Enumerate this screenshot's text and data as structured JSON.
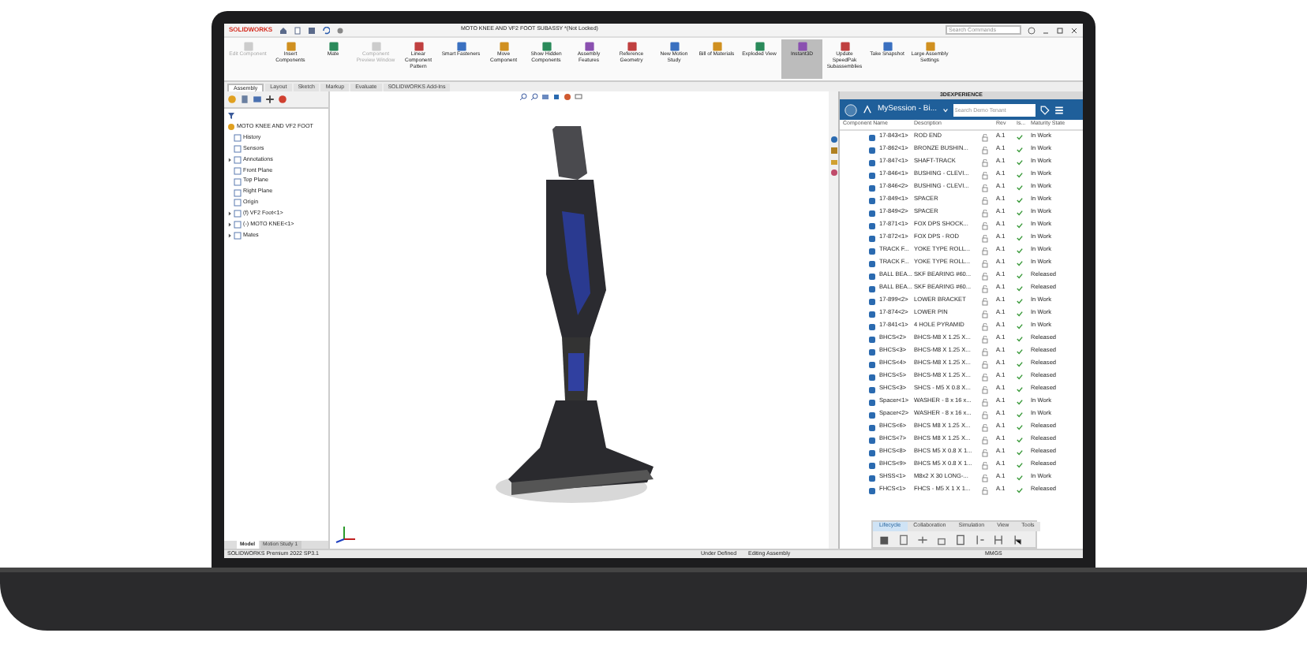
{
  "window": {
    "app": "SOLIDWORKS",
    "title": "MOTO KNEE AND VF2 FOOT SUBASSY *(Not Locked)",
    "search_placeholder": "Search Commands"
  },
  "ribbon": [
    {
      "label": "Edit Component",
      "disabled": true,
      "selected": false
    },
    {
      "label": "Insert Components",
      "disabled": false,
      "selected": false
    },
    {
      "label": "Mate",
      "disabled": false,
      "selected": false
    },
    {
      "label": "Component Preview Window",
      "disabled": true,
      "selected": false
    },
    {
      "label": "Linear Component Pattern",
      "disabled": false,
      "selected": false
    },
    {
      "label": "Smart Fasteners",
      "disabled": false,
      "selected": false
    },
    {
      "label": "Move Component",
      "disabled": false,
      "selected": false
    },
    {
      "label": "Show Hidden Components",
      "disabled": false,
      "selected": false
    },
    {
      "label": "Assembly Features",
      "disabled": false,
      "selected": false
    },
    {
      "label": "Reference Geometry",
      "disabled": false,
      "selected": false
    },
    {
      "label": "New Motion Study",
      "disabled": false,
      "selected": false
    },
    {
      "label": "Bill of Materials",
      "disabled": false,
      "selected": false
    },
    {
      "label": "Exploded View",
      "disabled": false,
      "selected": false
    },
    {
      "label": "Instant3D",
      "disabled": false,
      "selected": true
    },
    {
      "label": "Update SpeedPak Subassemblies",
      "disabled": false,
      "selected": false
    },
    {
      "label": "Take Snapshot",
      "disabled": false,
      "selected": false
    },
    {
      "label": "Large Assembly Settings",
      "disabled": false,
      "selected": false
    }
  ],
  "tabs": [
    {
      "label": "Assembly",
      "selected": true
    },
    {
      "label": "Layout",
      "selected": false
    },
    {
      "label": "Sketch",
      "selected": false
    },
    {
      "label": "Markup",
      "selected": false
    },
    {
      "label": "Evaluate",
      "selected": false
    },
    {
      "label": "SOLIDWORKS Add-Ins",
      "selected": false
    }
  ],
  "tree": {
    "root": "MOTO KNEE AND VF2 FOOT",
    "children": [
      {
        "label": "History",
        "has_children": false
      },
      {
        "label": "Sensors",
        "has_children": false
      },
      {
        "label": "Annotations",
        "has_children": true
      },
      {
        "label": "Front Plane",
        "has_children": false
      },
      {
        "label": "Top Plane",
        "has_children": false
      },
      {
        "label": "Right Plane",
        "has_children": false
      },
      {
        "label": "Origin",
        "has_children": false
      },
      {
        "label": "(f) VF2 Foot<1>",
        "has_children": true
      },
      {
        "label": "(-) MOTO KNEE<1>",
        "has_children": true
      },
      {
        "label": "Mates",
        "has_children": true
      }
    ]
  },
  "experience": {
    "header": "3DEXPERIENCE",
    "session": "MySession - Bi...",
    "search_placeholder": "Search Demo Tenant",
    "columns": [
      "Component Name",
      "Description",
      "Rev",
      "Is...",
      "Maturity State"
    ],
    "rows": [
      {
        "name": "17-843<1>",
        "description": "ROD END",
        "rev": "A.1",
        "checked": true,
        "state": "In Work"
      },
      {
        "name": "17-862<1>",
        "description": "BRONZE BUSHIN...",
        "rev": "A.1",
        "checked": true,
        "state": "In Work"
      },
      {
        "name": "17-847<1>",
        "description": "SHAFT-TRACK",
        "rev": "A.1",
        "checked": true,
        "state": "In Work"
      },
      {
        "name": "17-846<1>",
        "description": "BUSHING - CLEVI...",
        "rev": "A.1",
        "checked": true,
        "state": "In Work"
      },
      {
        "name": "17-846<2>",
        "description": "BUSHING - CLEVI...",
        "rev": "A.1",
        "checked": true,
        "state": "In Work"
      },
      {
        "name": "17-849<1>",
        "description": "SPACER",
        "rev": "A.1",
        "checked": true,
        "state": "In Work"
      },
      {
        "name": "17-849<2>",
        "description": "SPACER",
        "rev": "A.1",
        "checked": true,
        "state": "In Work"
      },
      {
        "name": "17-871<1>",
        "description": "FOX DPS SHOCK...",
        "rev": "A.1",
        "checked": true,
        "state": "In Work"
      },
      {
        "name": "17-872<1>",
        "description": "FOX DPS - ROD",
        "rev": "A.1",
        "checked": true,
        "state": "In Work"
      },
      {
        "name": "TRACK F...",
        "description": "YOKE TYPE ROLL...",
        "rev": "A.1",
        "checked": true,
        "state": "In Work"
      },
      {
        "name": "TRACK F...",
        "description": "YOKE TYPE ROLL...",
        "rev": "A.1",
        "checked": true,
        "state": "In Work"
      },
      {
        "name": "BALL BEA...",
        "description": "SKF BEARING #60...",
        "rev": "A.1",
        "checked": true,
        "state": "Released"
      },
      {
        "name": "BALL BEA...",
        "description": "SKF BEARING #60...",
        "rev": "A.1",
        "checked": true,
        "state": "Released"
      },
      {
        "name": "17-899<2>",
        "description": "LOWER BRACKET",
        "rev": "A.1",
        "checked": true,
        "state": "In Work"
      },
      {
        "name": "17-874<2>",
        "description": "LOWER PIN",
        "rev": "A.1",
        "checked": true,
        "state": "In Work"
      },
      {
        "name": "17-841<1>",
        "description": "4 HOLE PYRAMID",
        "rev": "A.1",
        "checked": true,
        "state": "In Work"
      },
      {
        "name": "BHCS<2>",
        "description": "BHCS-M8 X 1.25 X...",
        "rev": "A.1",
        "checked": true,
        "state": "Released"
      },
      {
        "name": "BHCS<3>",
        "description": "BHCS-M8 X 1.25 X...",
        "rev": "A.1",
        "checked": true,
        "state": "Released"
      },
      {
        "name": "BHCS<4>",
        "description": "BHCS-M8 X 1.25 X...",
        "rev": "A.1",
        "checked": true,
        "state": "Released"
      },
      {
        "name": "BHCS<5>",
        "description": "BHCS-M8 X 1.25 X...",
        "rev": "A.1",
        "checked": true,
        "state": "Released"
      },
      {
        "name": "SHCS<3>",
        "description": "SHCS - M5 X 0.8 X...",
        "rev": "A.1",
        "checked": true,
        "state": "Released"
      },
      {
        "name": "Spacer<1>",
        "description": "WASHER - 8 x 16 x...",
        "rev": "A.1",
        "checked": true,
        "state": "In Work"
      },
      {
        "name": "Spacer<2>",
        "description": "WASHER - 8 x 16 x...",
        "rev": "A.1",
        "checked": true,
        "state": "In Work"
      },
      {
        "name": "BHCS<6>",
        "description": "BHCS M8 X 1.25 X...",
        "rev": "A.1",
        "checked": true,
        "state": "Released"
      },
      {
        "name": "BHCS<7>",
        "description": "BHCS M8 X 1.25 X...",
        "rev": "A.1",
        "checked": true,
        "state": "Released"
      },
      {
        "name": "BHCS<8>",
        "description": "BHCS M5 X 0.8 X 1...",
        "rev": "A.1",
        "checked": true,
        "state": "Released"
      },
      {
        "name": "BHCS<9>",
        "description": "BHCS M5 X 0.8 X 1...",
        "rev": "A.1",
        "checked": true,
        "state": "Released"
      },
      {
        "name": "SHSS<1>",
        "description": "M8x2 X 30 LONG-...",
        "rev": "A.1",
        "checked": true,
        "state": "In Work"
      },
      {
        "name": "FHCS<1>",
        "description": "FHCS - M5 X 1 X 1...",
        "rev": "A.1",
        "checked": true,
        "state": "Released"
      }
    ],
    "bottom_tabs": [
      {
        "label": "Lifecycle",
        "selected": true
      },
      {
        "label": "Collaboration",
        "selected": false
      },
      {
        "label": "Simulation",
        "selected": false
      },
      {
        "label": "View",
        "selected": false
      },
      {
        "label": "Tools",
        "selected": false
      }
    ]
  },
  "model_tabs": [
    {
      "label": "Model",
      "selected": true
    },
    {
      "label": "Motion Study 1",
      "selected": false
    }
  ],
  "status_bar": [
    "SOLIDWORKS Premium 2022 SP3.1",
    "Under Defined",
    "Editing Assembly",
    "MMGS"
  ]
}
